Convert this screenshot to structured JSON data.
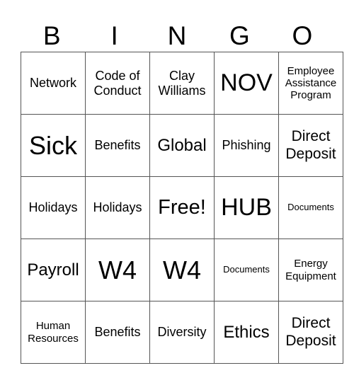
{
  "header": [
    "B",
    "I",
    "N",
    "G",
    "O"
  ],
  "rows": [
    [
      "Network",
      "Code of Conduct",
      "Clay Williams",
      "NOV",
      "Employee Assistance Program"
    ],
    [
      "Sick",
      "Benefits",
      "Global",
      "Phishing",
      "Direct Deposit"
    ],
    [
      "Holidays",
      "Holidays",
      "Free!",
      "HUB",
      "Documents"
    ],
    [
      "Payroll",
      "W4",
      "W4",
      "Documents",
      "Energy Equipment"
    ],
    [
      "Human Resources",
      "Benefits",
      "Diversity",
      "Ethics",
      "Direct Deposit"
    ]
  ]
}
